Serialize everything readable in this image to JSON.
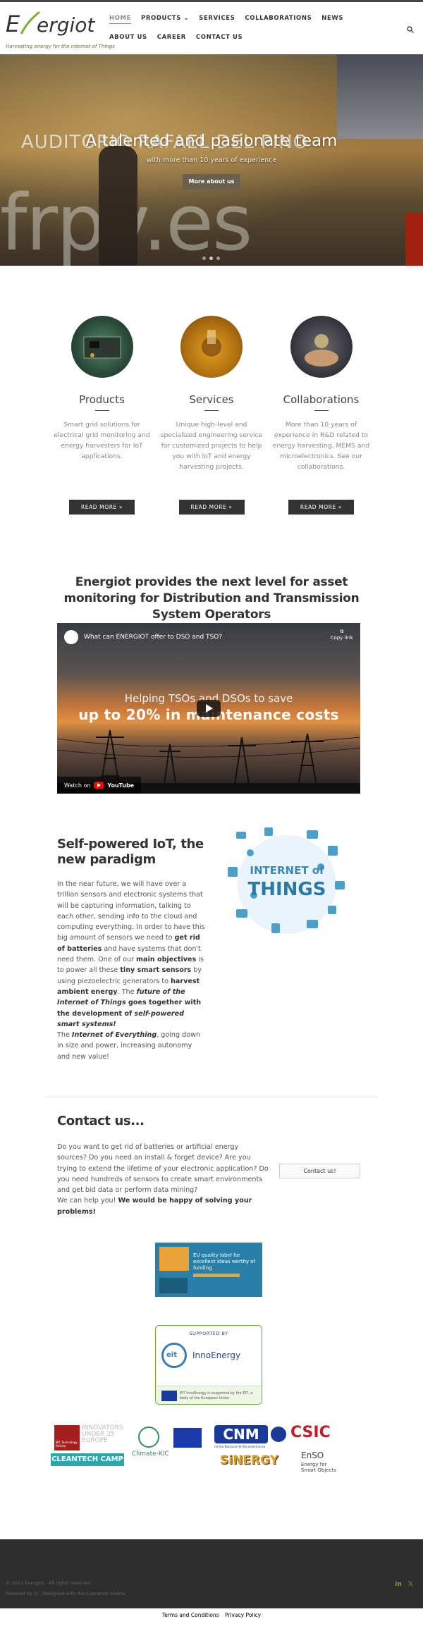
{
  "brand": {
    "logo_text": "Energiot",
    "tagline": "Harvesting energy for the internet of Things",
    "accent": "#7ab030"
  },
  "nav": {
    "items": [
      "HOME",
      "PRODUCTS",
      "SERVICES",
      "COLLABORATIONS",
      "NEWS",
      "ABOUT US",
      "CAREER",
      "CONTACT US"
    ],
    "products_has_dropdown": true
  },
  "hero": {
    "title": "A talented and pasionate team",
    "subtitle": "with more than 10 years of experience",
    "button": "More about us",
    "slide_count": 3,
    "active_slide": 2
  },
  "services": [
    {
      "title": "Products",
      "text": "Smart grid solutions for electrical grid monitoring and energy harvesters for IoT applications.",
      "button": "READ MORE »"
    },
    {
      "title": "Services",
      "text": "Unique high-level and specialized engineering service for customized projects to help you with IoT and energy harvesting projects.",
      "button": "READ MORE »"
    },
    {
      "title": "Collaborations",
      "text": "More than 10 years of experience in R&D related to energy harvesting, MEMS and microelectronics. See our collaborations.",
      "button": "READ MORE »"
    }
  ],
  "headline": "Energiot provides the next level for asset monitoring for Distribution and Transmission System Operators",
  "video": {
    "title": "What can ENERGIOT offer to DSO and TSO?",
    "copy_link": "Copy link",
    "overlay_line1": "Helping  TSOs and DSOs to save",
    "overlay_line2": "up to 20% in maintenance costs",
    "watch_on": "Watch on",
    "youtube": "YouTube"
  },
  "selfpowered": {
    "title": "Self-powered IoT, the new paradigm",
    "image_label_1": "INTERNET of",
    "image_label_2": "THINGS"
  },
  "contact": {
    "title": "Contact us...",
    "button": "Contact us!"
  },
  "eu_label": {
    "text": "EU quality label for excellent ideas worthy of funding"
  },
  "innoenergy": {
    "supported_by": "SUPPORTED BY",
    "eit": "eit",
    "name": "InnoEnergy",
    "footnote": "EIT InnoEnergy is supported by the EIT, a body of the European Union"
  },
  "sponsors": {
    "innovators": "INNOVATORS UNDER 35 EUROPE",
    "climate_kic": "Climate-KIC",
    "cleantech": "CLEANTECH CAMP",
    "cnm": "CNM",
    "cnm_sub": "Centro Nacional de Microelectrónica",
    "csic": "CSIC",
    "sinergy": "SiNERGY",
    "enso": "EnSO",
    "enso_sub": "Energy for Smart Objects",
    "mit": "MIT Technology Review"
  },
  "footer": {
    "copyright": "© 2021 Energiot - All rights reserved",
    "designed": "Powered by ⓦ - Designed with the Customizr theme",
    "social": [
      "in",
      "𝕏"
    ]
  },
  "bottom_links": [
    "Terms and Conditions",
    "Privacy Policy"
  ]
}
